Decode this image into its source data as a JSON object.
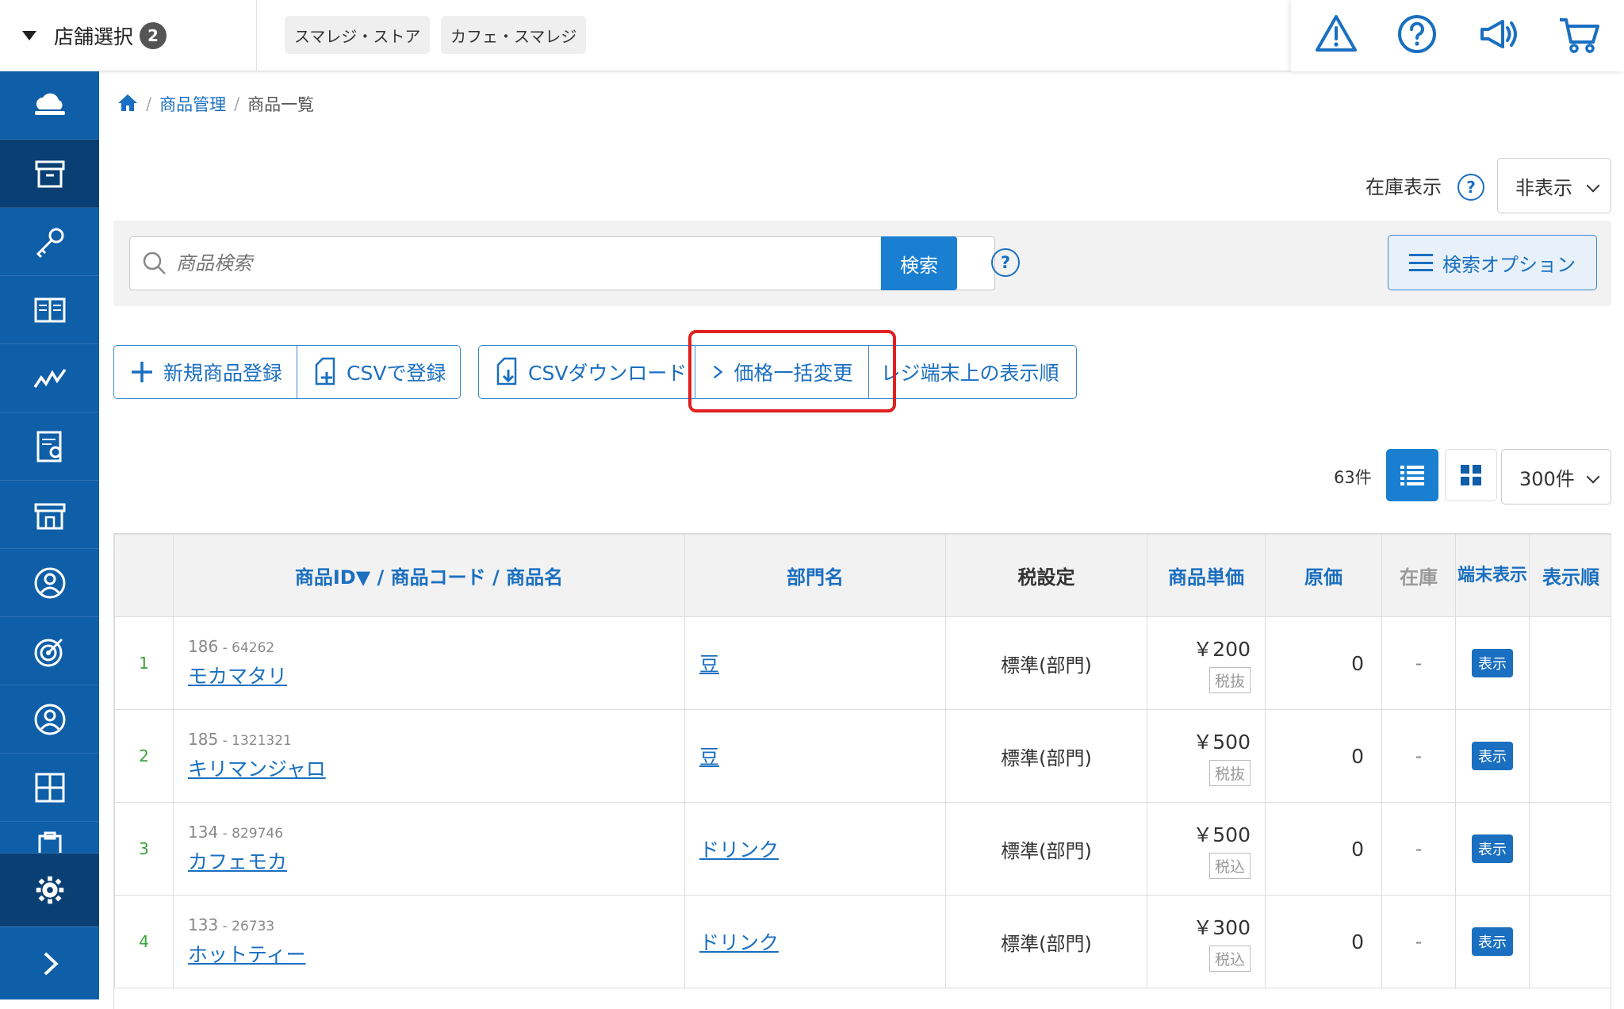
{
  "header": {
    "store_select_label": "店舗選択",
    "store_count": "2",
    "stores": [
      "スマレジ・ストア",
      "カフェ・スマレジ"
    ]
  },
  "breadcrumb": {
    "parent": "商品管理",
    "current": "商品一覧"
  },
  "stock_display": {
    "label": "在庫表示",
    "help": "?",
    "value": "非表示"
  },
  "search": {
    "placeholder": "商品検索",
    "button": "検索",
    "help": "?",
    "options_button": "検索オプション"
  },
  "actions": {
    "new_product": "新規商品登録",
    "csv_register": "CSVで登録",
    "csv_download": "CSVダウンロード",
    "bulk_price_change": "価格一括変更",
    "register_display_order": "レジ端末上の表示順"
  },
  "list_controls": {
    "count": "63件",
    "per_page": "300件"
  },
  "table": {
    "headers": {
      "id_name": "商品ID▼ / 商品コード / 商品名",
      "dept": "部門名",
      "tax": "税設定",
      "unit_price": "商品単価",
      "cost": "原価",
      "stock": "在庫",
      "terminal_display": "端末表示",
      "display_order": "表示順"
    },
    "rows": [
      {
        "no": "1",
        "id": "186",
        "code": "64262",
        "name": "モカマタリ",
        "dept": "豆",
        "tax": "標準(部門)",
        "price": "￥200",
        "tax_type": "税抜",
        "cost": "0",
        "stock": "-",
        "display": "表示"
      },
      {
        "no": "2",
        "id": "185",
        "code": "1321321",
        "name": "キリマンジャロ",
        "dept": "豆",
        "tax": "標準(部門)",
        "price": "￥500",
        "tax_type": "税抜",
        "cost": "0",
        "stock": "-",
        "display": "表示"
      },
      {
        "no": "3",
        "id": "134",
        "code": "829746",
        "name": "カフェモカ",
        "dept": "ドリンク",
        "tax": "標準(部門)",
        "price": "￥500",
        "tax_type": "税込",
        "cost": "0",
        "stock": "-",
        "display": "表示"
      },
      {
        "no": "4",
        "id": "133",
        "code": "26733",
        "name": "ホットティー",
        "dept": "ドリンク",
        "tax": "標準(部門)",
        "price": "￥300",
        "tax_type": "税込",
        "cost": "0",
        "stock": "-",
        "display": "表示"
      }
    ]
  },
  "colors": {
    "sidebar": "#0e5ea8",
    "sidebar_active": "#0a3f73",
    "accent": "#1a7fd1",
    "link": "#1a6fc0",
    "highlight": "#e02020"
  }
}
